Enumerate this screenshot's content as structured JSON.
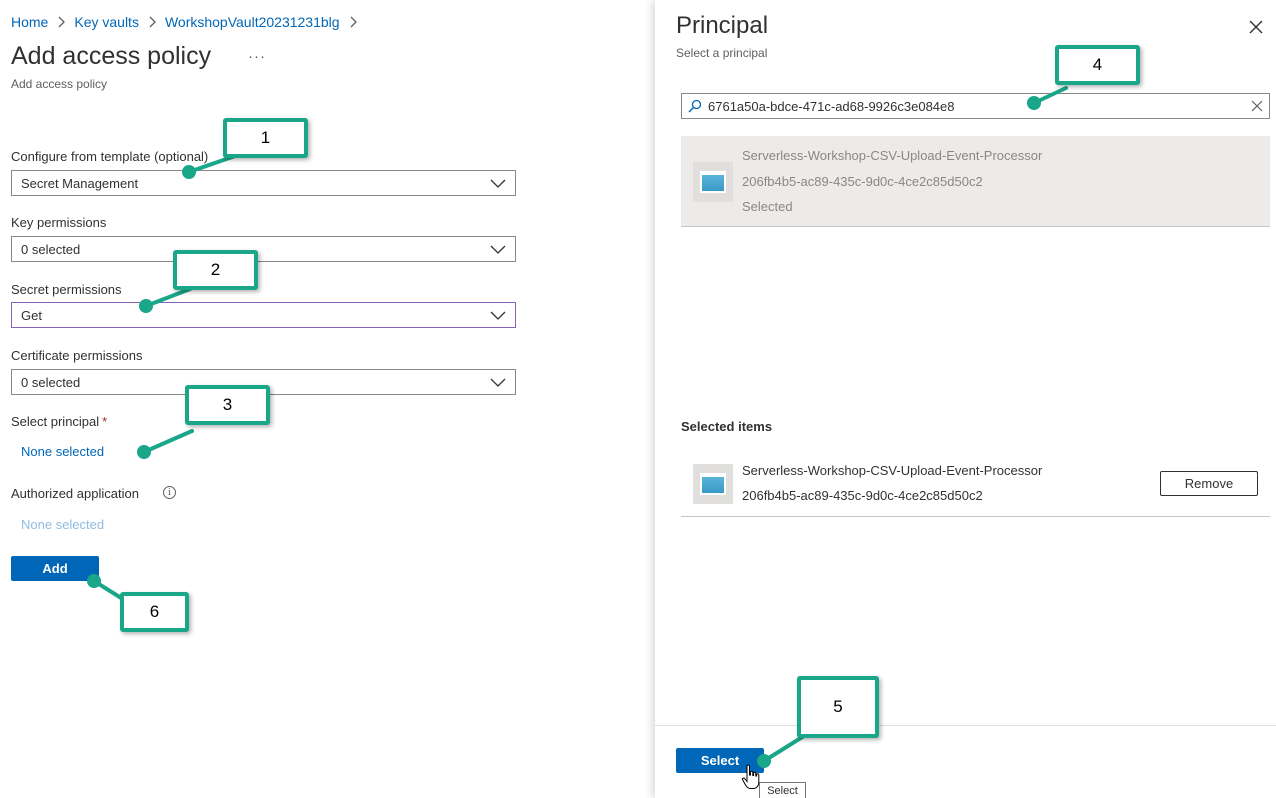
{
  "breadcrumb": {
    "items": [
      "Home",
      "Key vaults",
      "WorkshopVault20231231blg"
    ]
  },
  "blade": {
    "title": "Add access policy",
    "more_label": "···",
    "subtitle": "Add access policy"
  },
  "form": {
    "template_label": "Configure from template (optional)",
    "template_value": "Secret Management",
    "key_perm_label": "Key permissions",
    "key_perm_value": "0 selected",
    "secret_perm_label": "Secret permissions",
    "secret_perm_value": "Get",
    "cert_perm_label": "Certificate permissions",
    "cert_perm_value": "0 selected",
    "principal_label": "Select principal",
    "principal_required": "*",
    "principal_value": "None selected",
    "auth_app_label": "Authorized application",
    "auth_app_info": "i",
    "auth_app_value": "None selected",
    "add_label": "Add"
  },
  "panel": {
    "title": "Principal",
    "subtitle": "Select a principal",
    "search_value": "6761a50a-bdce-471c-ad68-9926c3e084e8",
    "result": {
      "name": "Serverless-Workshop-CSV-Upload-Event-Processor",
      "id": "206fb4b5-ac89-435c-9d0c-4ce2c85d50c2",
      "status": "Selected"
    },
    "selected_header": "Selected items",
    "selected_item": {
      "name": "Serverless-Workshop-CSV-Upload-Event-Processor",
      "id": "206fb4b5-ac89-435c-9d0c-4ce2c85d50c2"
    },
    "remove_label": "Remove",
    "select_label": "Select",
    "tooltip": "Select"
  },
  "callouts": [
    "1",
    "2",
    "3",
    "4",
    "5",
    "6"
  ],
  "colors": {
    "accent": "#0067b8",
    "callout_border": "#1aa688",
    "focus_border": "#8764b8",
    "required": "#a4262c"
  },
  "icons": [
    "chevron-right-icon",
    "chevron-down-icon",
    "info-icon",
    "close-icon",
    "search-icon",
    "clear-icon",
    "app-registration-icon",
    "hand-cursor-icon"
  ]
}
